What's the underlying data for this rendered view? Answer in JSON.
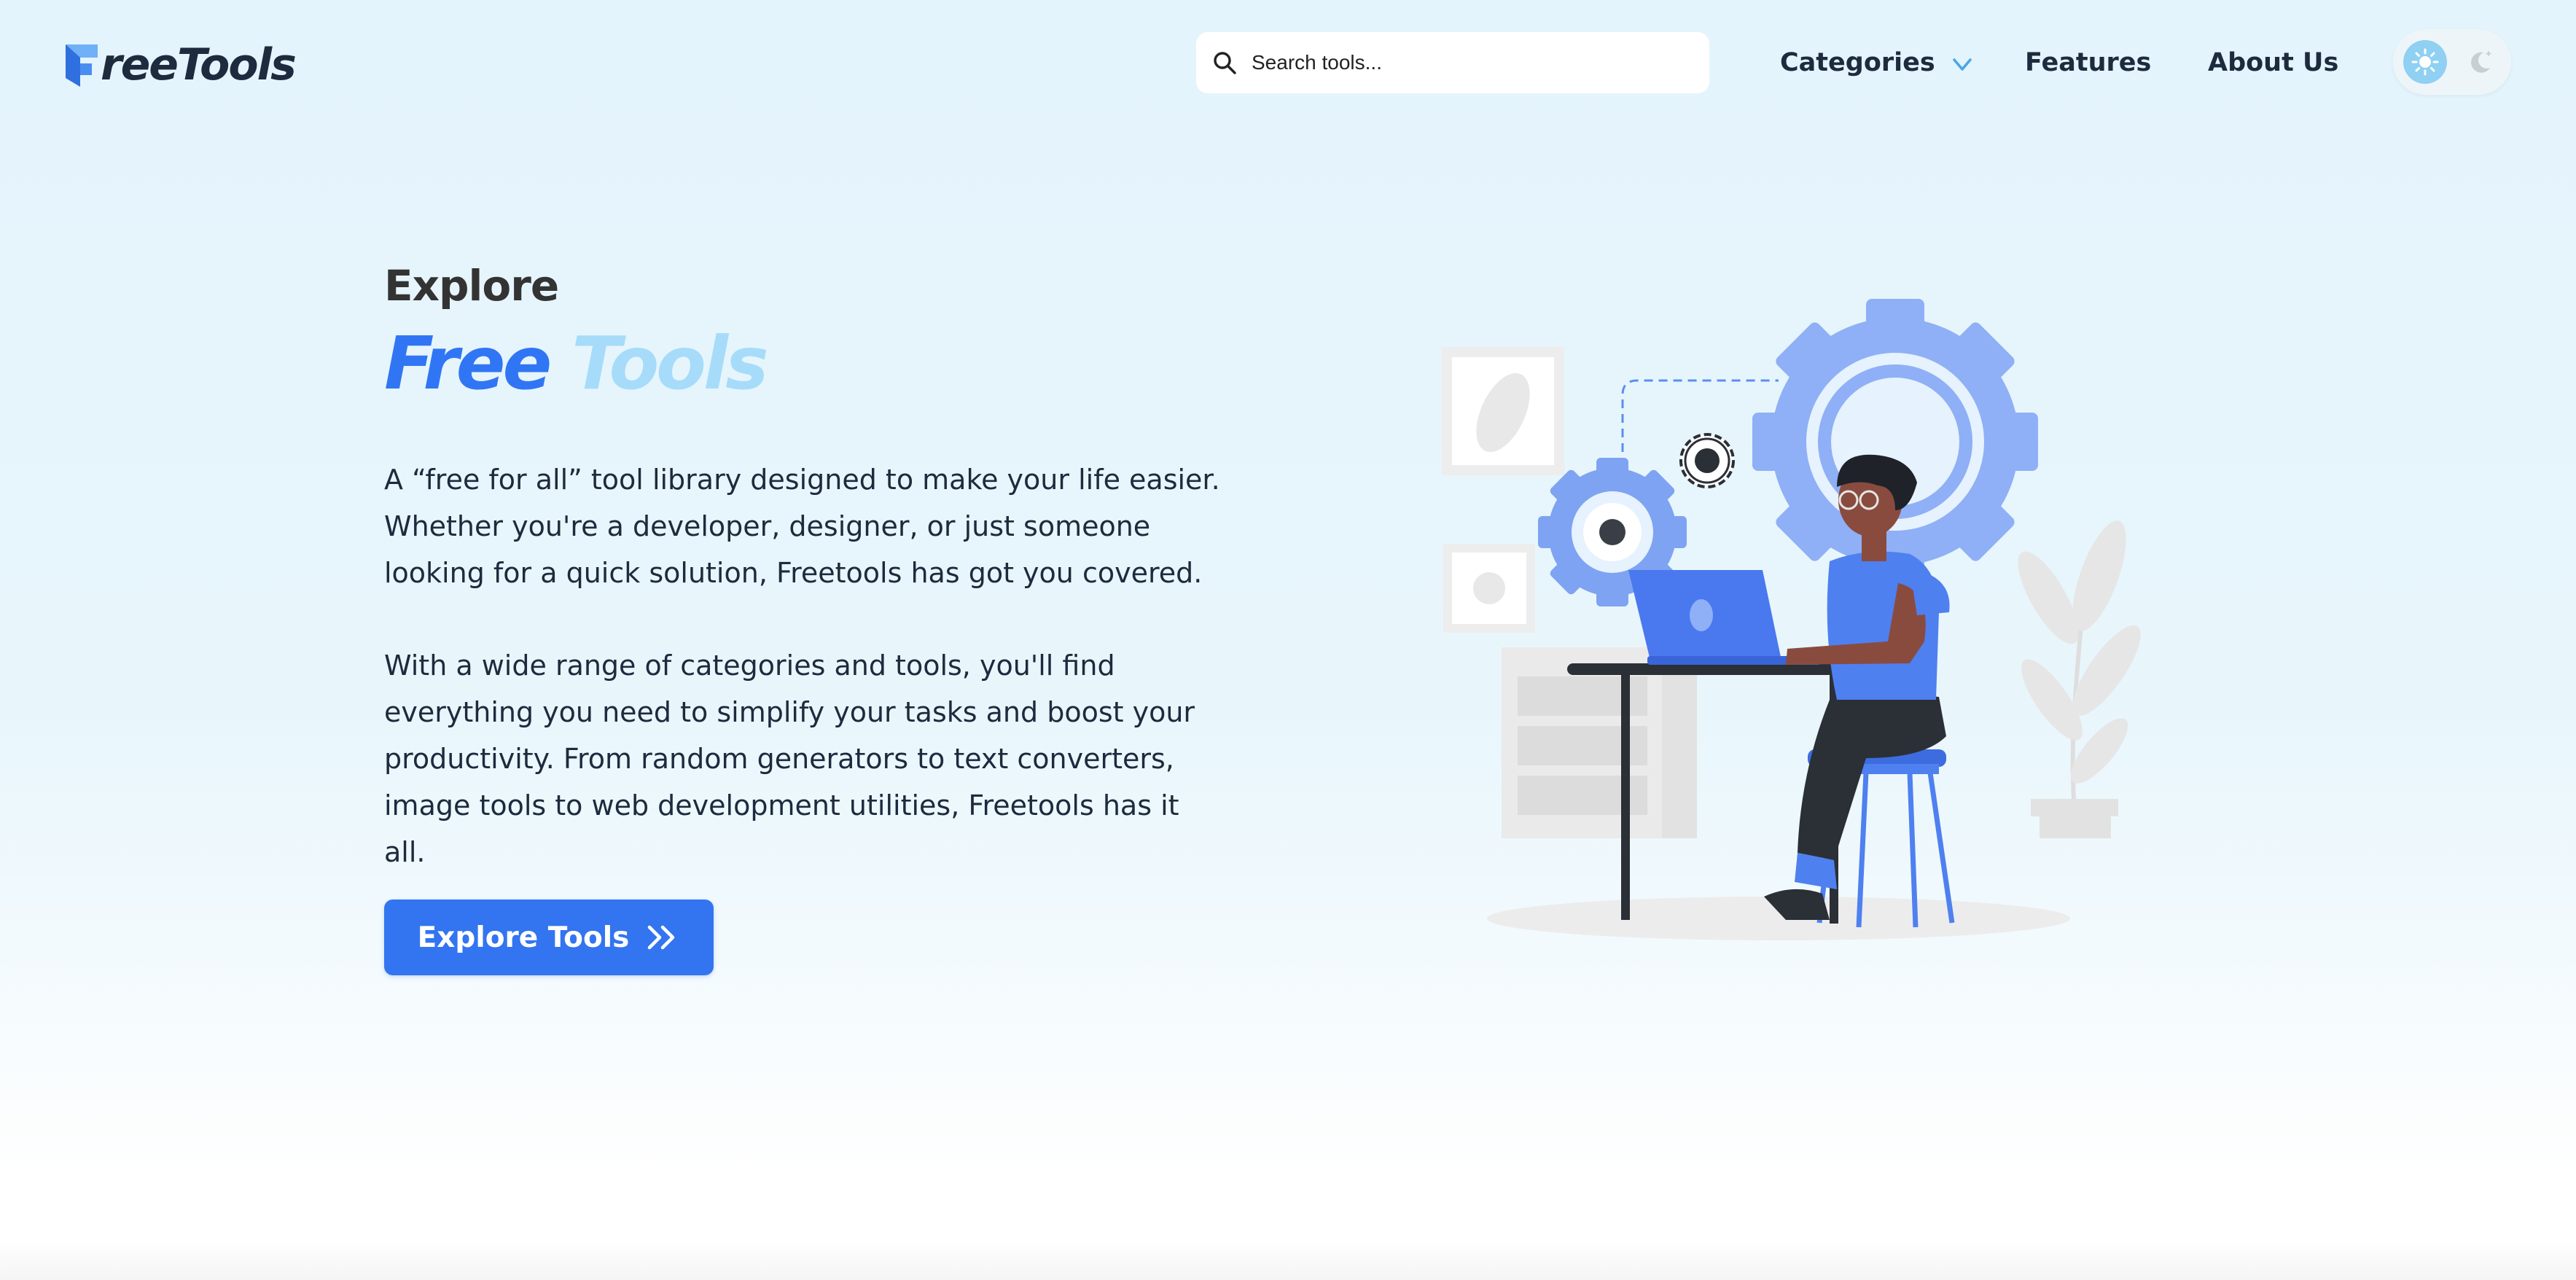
{
  "header": {
    "logo_text": "reeTools",
    "search": {
      "placeholder": "Search tools...",
      "value": ""
    },
    "nav": {
      "categories": "Categories",
      "features": "Features",
      "about": "About Us"
    },
    "theme_toggle": {
      "active": "light",
      "options": [
        "light",
        "dark"
      ]
    }
  },
  "hero": {
    "eyebrow": "Explore",
    "title_part1": "Free",
    "title_part2": "Tools",
    "paragraph1": "A “free for all” tool library designed to make your life easier. Whether you're a developer, designer, or just someone looking for a quick solution, Freetools has got you covered.",
    "paragraph2": "With a wide range of categories and tools, you'll find everything you need to simplify your tasks and boost your productivity. From random generators to text converters, image tools to web development utilities, Freetools has it all.",
    "cta_label": "Explore Tools"
  },
  "icons": {
    "search": "search-icon",
    "chevron": "chevron-down-icon",
    "sun": "sun-icon",
    "moon": "moon-icon",
    "cta": "double-chevron-right-icon"
  },
  "colors": {
    "primary": "#3375f0",
    "title_blue": "#3076f4",
    "title_light_blue": "#a6dcfa",
    "text_dark": "#1e2a3d",
    "background": "#e4f4fc"
  }
}
